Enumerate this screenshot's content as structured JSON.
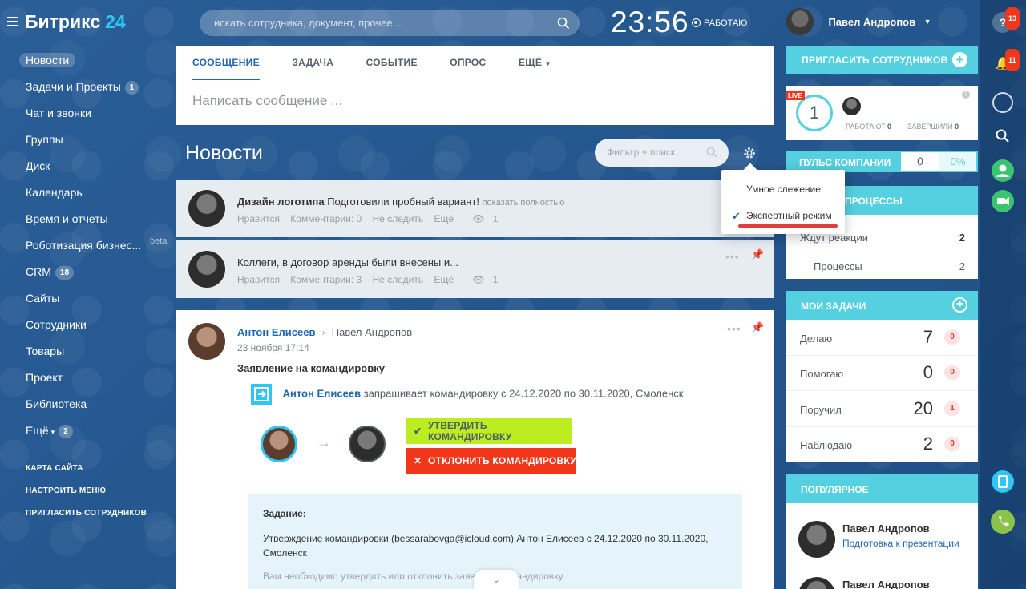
{
  "header": {
    "brand_name": "Битрикс",
    "brand_num": "24",
    "search_placeholder": "искать сотрудника, документ, прочее...",
    "clock": "23:56",
    "status": "РАБОТАЮ",
    "user_name": "Павел Андропов"
  },
  "sidebar": {
    "items": [
      {
        "label": "Новости",
        "count": ""
      },
      {
        "label": "Задачи и Проекты",
        "count": "1"
      },
      {
        "label": "Чат и звонки",
        "count": ""
      },
      {
        "label": "Группы",
        "count": ""
      },
      {
        "label": "Диск",
        "count": ""
      },
      {
        "label": "Календарь",
        "count": ""
      },
      {
        "label": "Время и отчеты",
        "count": ""
      },
      {
        "label": "Роботизация бизнес...",
        "count": ""
      },
      {
        "label": "CRM",
        "count": "18"
      },
      {
        "label": "Сайты",
        "count": ""
      },
      {
        "label": "Сотрудники",
        "count": ""
      },
      {
        "label": "Товары",
        "count": ""
      },
      {
        "label": "Проект",
        "count": ""
      },
      {
        "label": "Библиотека",
        "count": ""
      },
      {
        "label": "Ещё",
        "count": "2"
      }
    ],
    "beta": "beta",
    "links": [
      "КАРТА САЙТА",
      "НАСТРОИТЬ МЕНЮ",
      "ПРИГЛАСИТЬ СОТРУДНИКОВ"
    ]
  },
  "composer": {
    "tabs": [
      "СООБЩЕНИЕ",
      "ЗАДАЧА",
      "СОБЫТИЕ",
      "ОПРОС",
      "ЕЩЁ"
    ],
    "placeholder": "Написать сообщение ..."
  },
  "feed": {
    "title": "Новости",
    "filter_placeholder": "Фильтр + поиск",
    "collapsed_posts": [
      {
        "title": "Дизайн логотипа",
        "text": "Подготовили пробный вариант!",
        "more": "показать полностью",
        "like": "Нравится",
        "comments": "Комментарии: 0",
        "unfollow": "Не следить",
        "extra": "Ещё",
        "views": "1"
      },
      {
        "title": "",
        "text": "Коллеги, в договор аренды были внесены и...",
        "more": "",
        "like": "Нравится",
        "comments": "Комментарии: 3",
        "unfollow": "Не следить",
        "extra": "Ещё",
        "views": "1"
      }
    ],
    "post": {
      "author": "Антон Елисеев",
      "recipient": "Павел Андропов",
      "date": "23 ноября 17:14",
      "title": "Заявление на командировку",
      "req_author": "Антон Елисеев",
      "req_text": "запрашивает командировку с 24.12.2020 по 30.11.2020, Смоленск",
      "approve": "УТВЕРДИТЬ КОМАНДИРОВКУ",
      "reject": "ОТКЛОНИТЬ КОМАНДИРОВКУ",
      "task_heading": "Задание:",
      "task_body": "Утверждение командировки (bessarabovga@icloud.com) Антон Елисеев с 24.12.2020 по 30.11.2020, Смоленск",
      "task_cut": "Вам необходимо утвердить или отклонить заявку на командировку."
    }
  },
  "popup": {
    "items": [
      "Умное слежение",
      "Экспертный режим"
    ]
  },
  "right": {
    "invite": "ПРИГЛАСИТЬ СОТРУДНИКОВ",
    "live_badge": "LIVE",
    "live_count": "1",
    "working_label": "РАБОТАЮТ",
    "working_value": "0",
    "finished_label": "ЗАВЕРШИЛИ",
    "finished_value": "0",
    "pulse_label": "ПУЛЬС КОМПАНИИ",
    "pulse_value": "0",
    "pulse_pct": "0%",
    "processes_title": "ПРОЦЕССЫ",
    "processes_rows": [
      {
        "label": "Ждут реакции",
        "value": "2"
      },
      {
        "label": "Процессы",
        "value": "2"
      }
    ],
    "tasks_title": "МОИ ЗАДАЧИ",
    "tasks": [
      {
        "label": "Делаю",
        "value": "7",
        "overdue": "0"
      },
      {
        "label": "Помогаю",
        "value": "0",
        "overdue": "0"
      },
      {
        "label": "Поручил",
        "value": "20",
        "overdue": "1"
      },
      {
        "label": "Наблюдаю",
        "value": "2",
        "overdue": "0"
      }
    ],
    "popular_title": "ПОПУЛЯРНОЕ",
    "popular_name": "Павел Андропов",
    "popular_link": "Подготовка к презентации",
    "popular_name2": "Павел Андропов"
  },
  "rightbar": {
    "help_badge": "13",
    "notif_badge": "11"
  }
}
